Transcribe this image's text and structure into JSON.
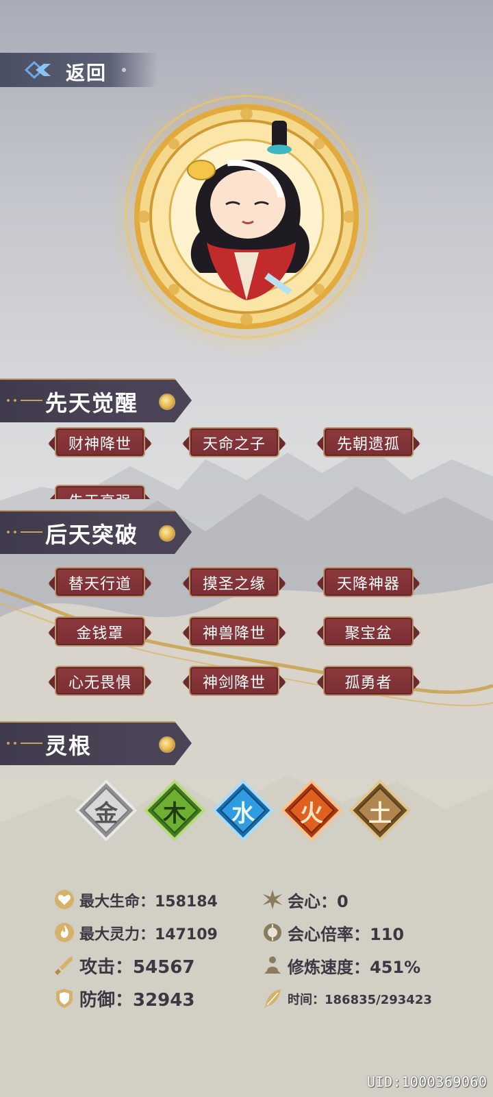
{
  "header": {
    "back_label": "返回"
  },
  "sections": {
    "innate": {
      "title": "先天觉醒",
      "tags": [
        "财神降世",
        "天命之子",
        "先朝遗孤",
        "先天高强"
      ]
    },
    "acquired": {
      "title": "后天突破",
      "tags": [
        "替天行道",
        "摸圣之缘",
        "天降神器",
        "金钱罩",
        "神兽降世",
        "聚宝盆",
        "心无畏惧",
        "神剑降世",
        "孤勇者"
      ]
    },
    "spirit_root": {
      "title": "灵根",
      "elements": [
        {
          "glyph": "金",
          "icon": "metal-element-icon",
          "color": "#c9c9c9"
        },
        {
          "glyph": "木",
          "icon": "wood-element-icon",
          "color": "#5b9a2a"
        },
        {
          "glyph": "水",
          "icon": "water-element-icon",
          "color": "#2a8fce"
        },
        {
          "glyph": "火",
          "icon": "fire-element-icon",
          "color": "#d9541c"
        },
        {
          "glyph": "土",
          "icon": "earth-element-icon",
          "color": "#a27a44"
        }
      ]
    }
  },
  "stats": {
    "max_hp": "最大生命：158184",
    "crit": "会心：0",
    "max_spirit": "最大灵力：147109",
    "crit_rate": "会心倍率：110",
    "attack": "攻击：54567",
    "cultivation_speed": "修炼速度：451%",
    "defense": "防御：32943",
    "time": "时间：186835/293423"
  },
  "uid": "UID:1000369060"
}
